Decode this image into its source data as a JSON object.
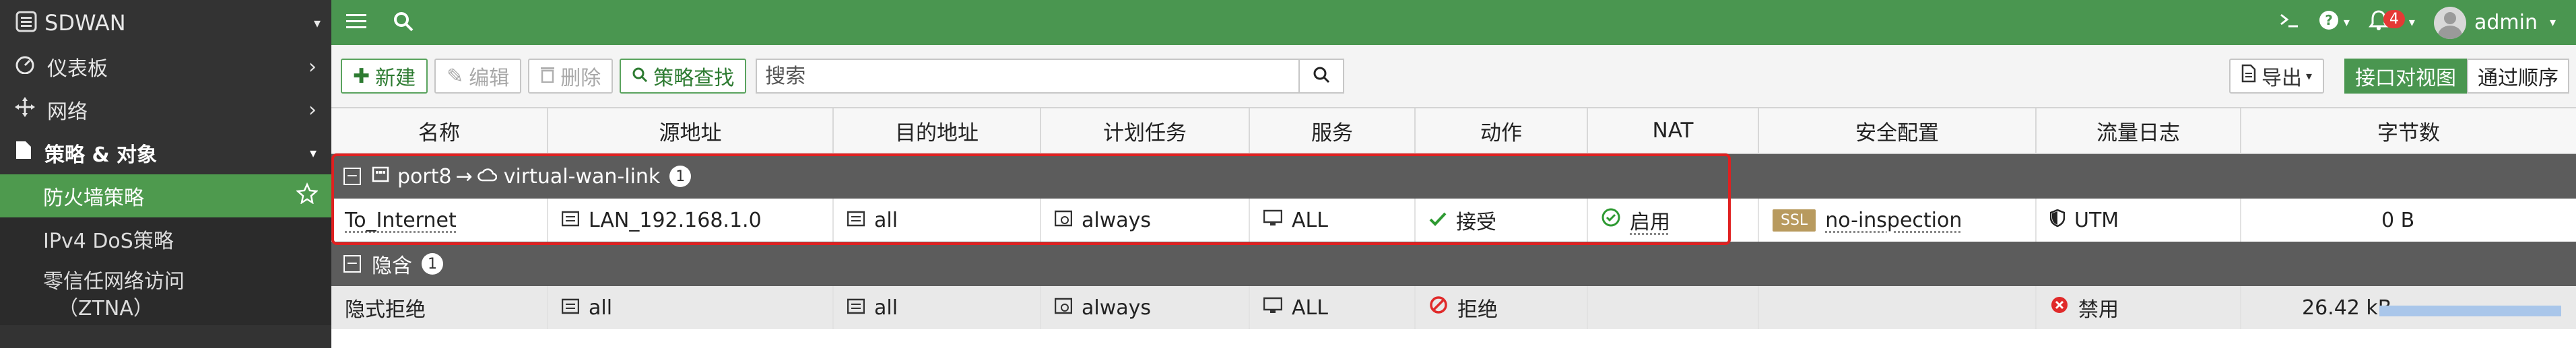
{
  "sidebar": {
    "app_title": "SDWAN",
    "items": [
      {
        "label": "仪表板"
      },
      {
        "label": "网络"
      },
      {
        "label": "策略 & 对象"
      }
    ],
    "subitems": [
      {
        "label": "防火墙策略"
      },
      {
        "label": "IPv4 DoS策略"
      },
      {
        "label_line1": "零信任网络访问",
        "label_line2": "（ZTNA）"
      }
    ]
  },
  "topbar": {
    "notification_count": "4",
    "user": "admin"
  },
  "toolbar": {
    "new_label": "新建",
    "edit_label": "编辑",
    "delete_label": "删除",
    "policy_lookup_label": "策略查找",
    "search_placeholder": "搜索",
    "export_label": "导出",
    "view_interface_pair": "接口对视图",
    "view_sequence": "通过顺序"
  },
  "table": {
    "columns": [
      "名称",
      "源地址",
      "目的地址",
      "计划任务",
      "服务",
      "动作",
      "NAT",
      "安全配置",
      "流量日志",
      "字节数"
    ],
    "groups": [
      {
        "title_from": "port8",
        "arrow": "→",
        "title_to": "virtual-wan-link",
        "count": "1",
        "rows": [
          {
            "name": "To_Internet",
            "src": "LAN_192.168.1.0",
            "dst": "all",
            "schedule": "always",
            "service": "ALL",
            "action": "接受",
            "nat": "启用",
            "ssl_badge": "SSL",
            "security": "no-inspection",
            "log": "UTM",
            "bytes": "0 B"
          }
        ]
      },
      {
        "title": "隐含",
        "count": "1",
        "rows": [
          {
            "name": "隐式拒绝",
            "src": "all",
            "dst": "all",
            "schedule": "always",
            "service": "ALL",
            "action": "拒绝",
            "nat": "",
            "security": "",
            "log": "禁用",
            "bytes": "26.42 kB",
            "bytes_bar_fraction": 0.9
          }
        ]
      }
    ]
  },
  "colors": {
    "accent": "#4a9650",
    "sidebar": "#333333",
    "highlight_frame": "#e02020",
    "accept": "#2e9a32",
    "deny": "#e02a2a"
  }
}
